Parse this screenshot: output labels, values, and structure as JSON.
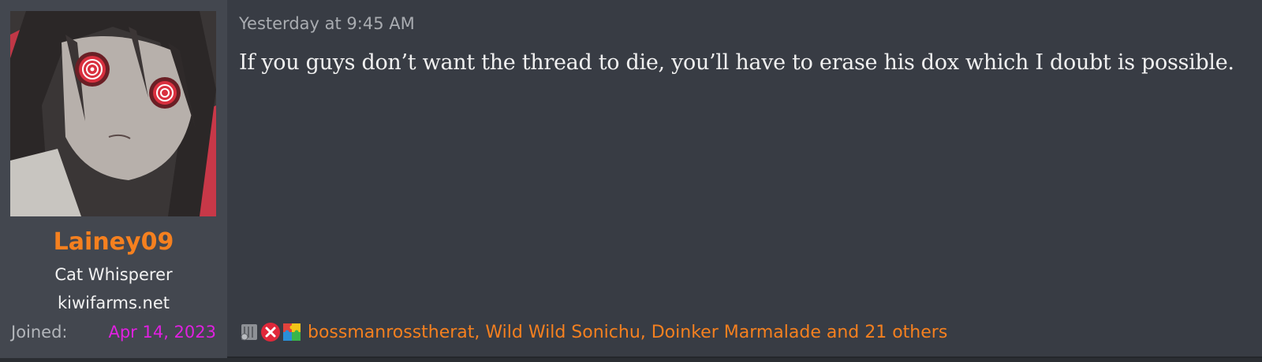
{
  "post": {
    "author": {
      "username": "Lainey09",
      "title": "Cat Whisperer",
      "banner": "kiwifarms.net",
      "joined_label": "Joined:",
      "joined_date": "Apr 14, 2023",
      "username_color": "#f5801f",
      "joined_date_color": "#e020e0"
    },
    "timestamp": "Yesterday at 9:45 AM",
    "message": "If you guys don’t want the thread to die, you’ll have to erase his dox which I doubt is possible.",
    "reactions": {
      "icons": [
        "dumpster-fire-icon",
        "x-mark-icon",
        "autism-puzzle-icon"
      ],
      "summary": "bossmanrosstherat, Wild Wild Sonichu, Doinker Marmalade and 21 others"
    }
  }
}
